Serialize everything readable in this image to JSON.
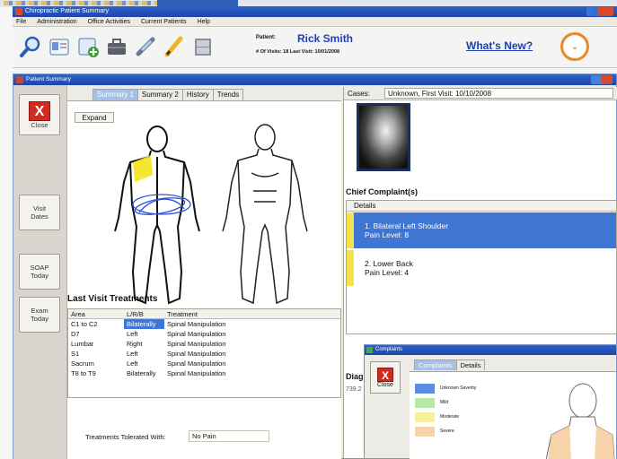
{
  "app": {
    "title": "Chiropractic Patient Summary",
    "menu": [
      "File",
      "Administration",
      "Office Activities",
      "Current Patients",
      "Help"
    ],
    "patient_label": "Patient:",
    "patient_name": "Rick Smith",
    "visits_line": "# Of Visits: 18    Last Visit: 10/01/2008",
    "whats_new": "What's New?"
  },
  "summary_window": {
    "title": "Patient Summary",
    "close_label": "Close",
    "sidebar_buttons": [
      "Visit Dates",
      "SOAP Today",
      "Exam Today"
    ],
    "tabs": [
      "Summary 1",
      "Summary 2",
      "History",
      "Trends"
    ],
    "expand_label": "Expand",
    "last_visit_title": "Last Visit Treatments",
    "treatment_columns": [
      "Area",
      "L/R/B",
      "Treatment"
    ],
    "treatments": [
      {
        "area": "C1 to C2",
        "side": "Bilaterally",
        "treatment": "Spinal Manipulation"
      },
      {
        "area": "D7",
        "side": "Left",
        "treatment": "Spinal Manipulation"
      },
      {
        "area": "Lumbar",
        "side": "Right",
        "treatment": "Spinal Manipulation"
      },
      {
        "area": "S1",
        "side": "Left",
        "treatment": "Spinal Manipulation"
      },
      {
        "area": "Sacrum",
        "side": "Left",
        "treatment": "Spinal Manipulation"
      },
      {
        "area": "T8 to T9",
        "side": "Bilaterally",
        "treatment": "Spinal Manipulation"
      }
    ],
    "tolerated_label": "Treatments Tolerated With:",
    "tolerated_value": "No Pain",
    "cases_label": "Cases:",
    "cases_value": "Unknown,  First Visit: 10/10/2008",
    "chief_complaints_title": "Chief Complaint(s)",
    "complaints_header": "Details",
    "complaints": [
      {
        "line1": "1. Bilateral Left Shoulder",
        "line2": "Pain Level: 8"
      },
      {
        "line1": "2. Lower Back",
        "line2": "Pain Level: 4"
      }
    ],
    "diag_label": "Diag",
    "diag_code": "739.2"
  },
  "complaints_popup": {
    "title": "Complaints",
    "close_label": "Close",
    "tabs": [
      "Complaints",
      "Details"
    ],
    "legend": [
      {
        "label": "Unknown Severity",
        "color": "#5b8ee0"
      },
      {
        "label": "Mild",
        "color": "#b6e8a8"
      },
      {
        "label": "Moderate",
        "color": "#f6f19a"
      },
      {
        "label": "Severe",
        "color": "#f8d2a8"
      }
    ]
  }
}
